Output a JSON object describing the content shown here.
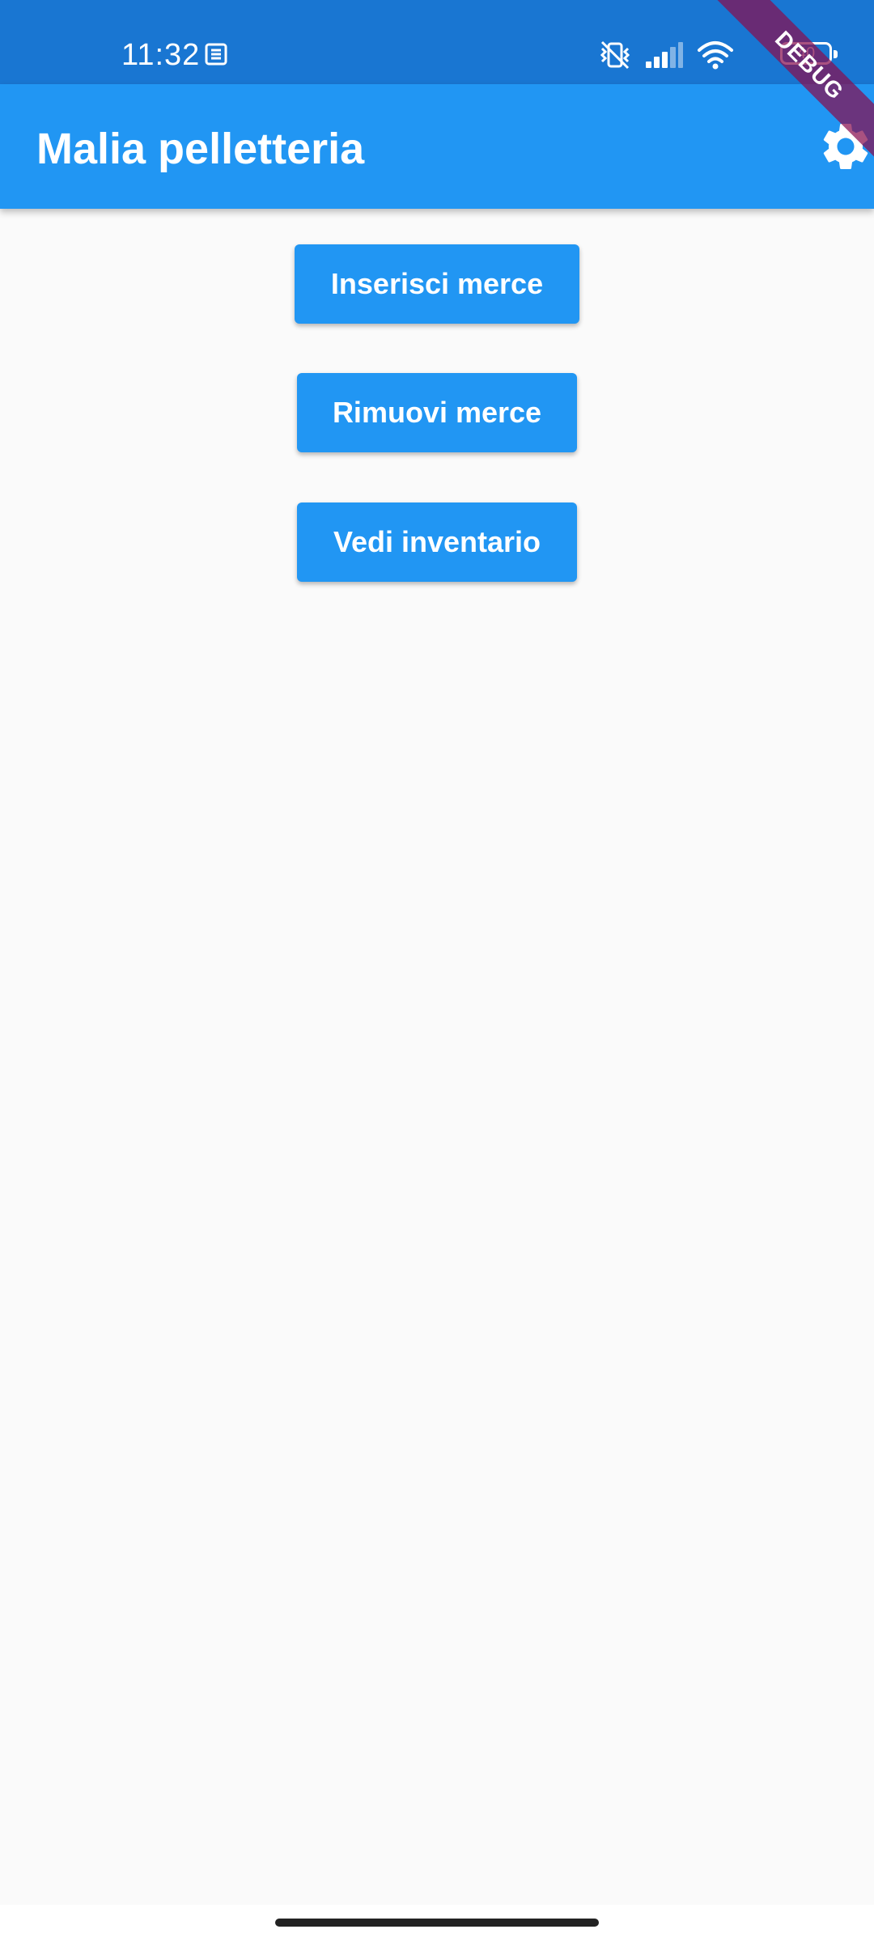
{
  "status_bar": {
    "time": "11:32",
    "battery_level": "40",
    "icons": [
      "news-icon",
      "vibrate-off-icon",
      "signal-icon",
      "wifi-icon",
      "battery-icon"
    ]
  },
  "debug_banner": "DEBUG",
  "app_bar": {
    "title": "Malia pelletteria",
    "settings_icon": "gear-icon"
  },
  "actions": {
    "insert_label": "Inserisci merce",
    "remove_label": "Rimuovi merce",
    "inventory_label": "Vedi inventario"
  },
  "colors": {
    "status_bar": "#1976d2",
    "primary": "#2196f3",
    "background": "#fafafa",
    "debug_banner": "#880e4f"
  }
}
